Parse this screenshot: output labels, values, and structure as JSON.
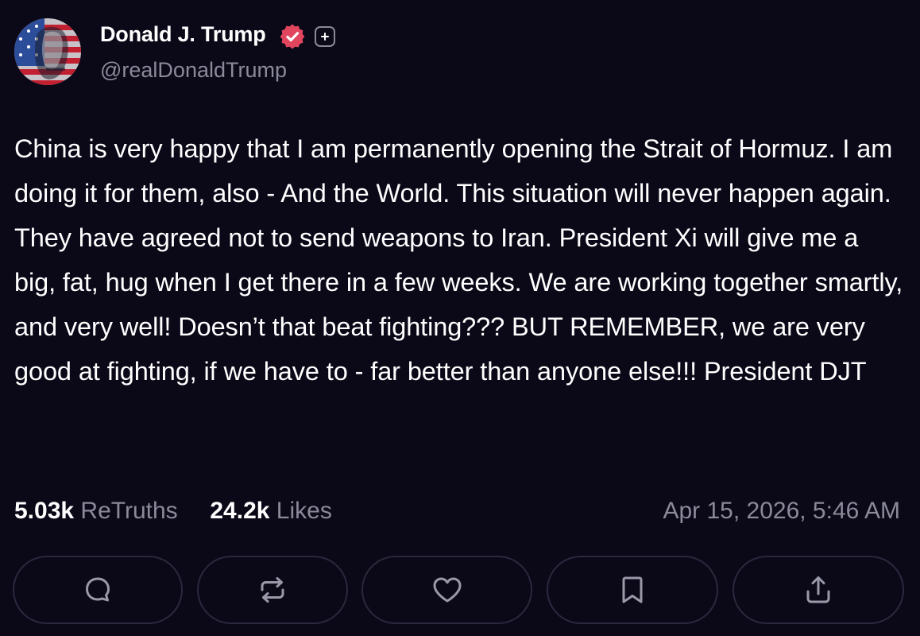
{
  "author": {
    "name": "Donald J. Trump",
    "handle": "@realDonaldTrump",
    "avatar_icon": "flag-portrait-avatar",
    "verified_icon": "verified-badge-icon",
    "follow_icon": "add-icon"
  },
  "post": {
    "text": "China is very happy that I am permanently opening the Strait of Hormuz. I am doing it for them, also - And the World. This situation will never happen again. They have agreed not to send weapons to Iran. President Xi will give me a big, fat, hug when I get there in a few weeks. We are working together smartly, and very well! Doesn’t that beat fighting??? BUT REMEMBER, we are very good at fighting, if we have to - far better than anyone else!!! President DJT"
  },
  "stats": {
    "retruths_count": "5.03k",
    "retruths_label": "ReTruths",
    "likes_count": "24.2k",
    "likes_label": "Likes",
    "timestamp": "Apr 15, 2026, 5:46 AM"
  },
  "actions": [
    {
      "name": "reply",
      "icon": "comment-icon"
    },
    {
      "name": "retruth",
      "icon": "repost-icon"
    },
    {
      "name": "like",
      "icon": "heart-icon"
    },
    {
      "name": "bookmark",
      "icon": "bookmark-icon"
    },
    {
      "name": "share",
      "icon": "share-icon"
    }
  ],
  "colors": {
    "background": "#0b0918",
    "text": "#ffffff",
    "muted": "#8b8a9b",
    "verified": "#e2465f",
    "button_border": "#2a283d"
  }
}
